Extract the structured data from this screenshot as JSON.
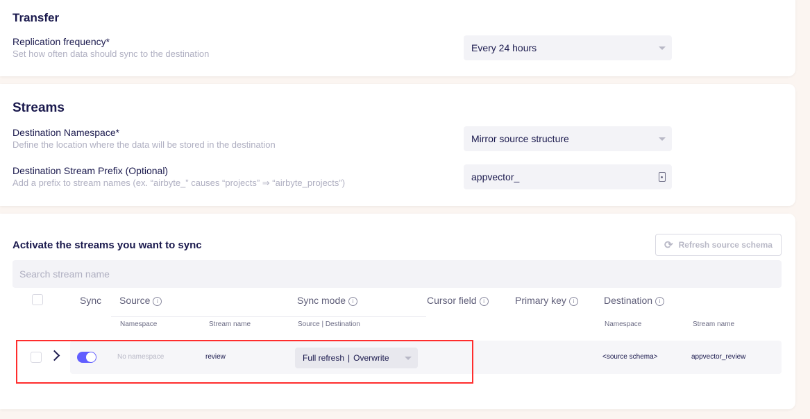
{
  "transfer": {
    "title": "Transfer",
    "replication_label": "Replication frequency*",
    "replication_desc": "Set how often data should sync to the destination",
    "replication_value": "Every 24 hours"
  },
  "streams": {
    "title": "Streams",
    "namespace_label": "Destination Namespace*",
    "namespace_desc": "Define the location where the data will be stored in the destination",
    "namespace_value": "Mirror source structure",
    "prefix_label": "Destination Stream Prefix (Optional)",
    "prefix_desc": "Add a prefix to stream names (ex. “airbyte_” causes “projects” ⇒ “airbyte_projects”)",
    "prefix_value": "appvector_"
  },
  "activate": {
    "title": "Activate the streams you want to sync",
    "refresh_label": "Refresh source schema",
    "search_placeholder": "Search stream name",
    "headers": {
      "sync": "Sync",
      "source": "Source",
      "sync_mode": "Sync mode",
      "cursor_field": "Cursor field",
      "primary_key": "Primary key",
      "destination": "Destination"
    },
    "subheaders": {
      "source_namespace": "Namespace",
      "source_stream_name": "Stream name",
      "sync_mode_detail": "Source | Destination",
      "dest_namespace": "Namespace",
      "dest_stream_name": "Stream name"
    },
    "row": {
      "namespace": "No namespace",
      "stream_name": "review",
      "sync_source": "Full refresh",
      "sync_separator": "|",
      "sync_destination": "Overwrite",
      "dest_namespace": "<source schema>",
      "dest_stream_name": "appvector_review",
      "sync_enabled": true
    }
  },
  "colors": {
    "accent": "#615eff",
    "highlight": "#ff2d2d",
    "background": "#fbf5f1"
  },
  "icons": [
    "info-icon",
    "refresh-icon",
    "chevron-right-icon",
    "input-action-icon",
    "dropdown-caret-icon"
  ]
}
